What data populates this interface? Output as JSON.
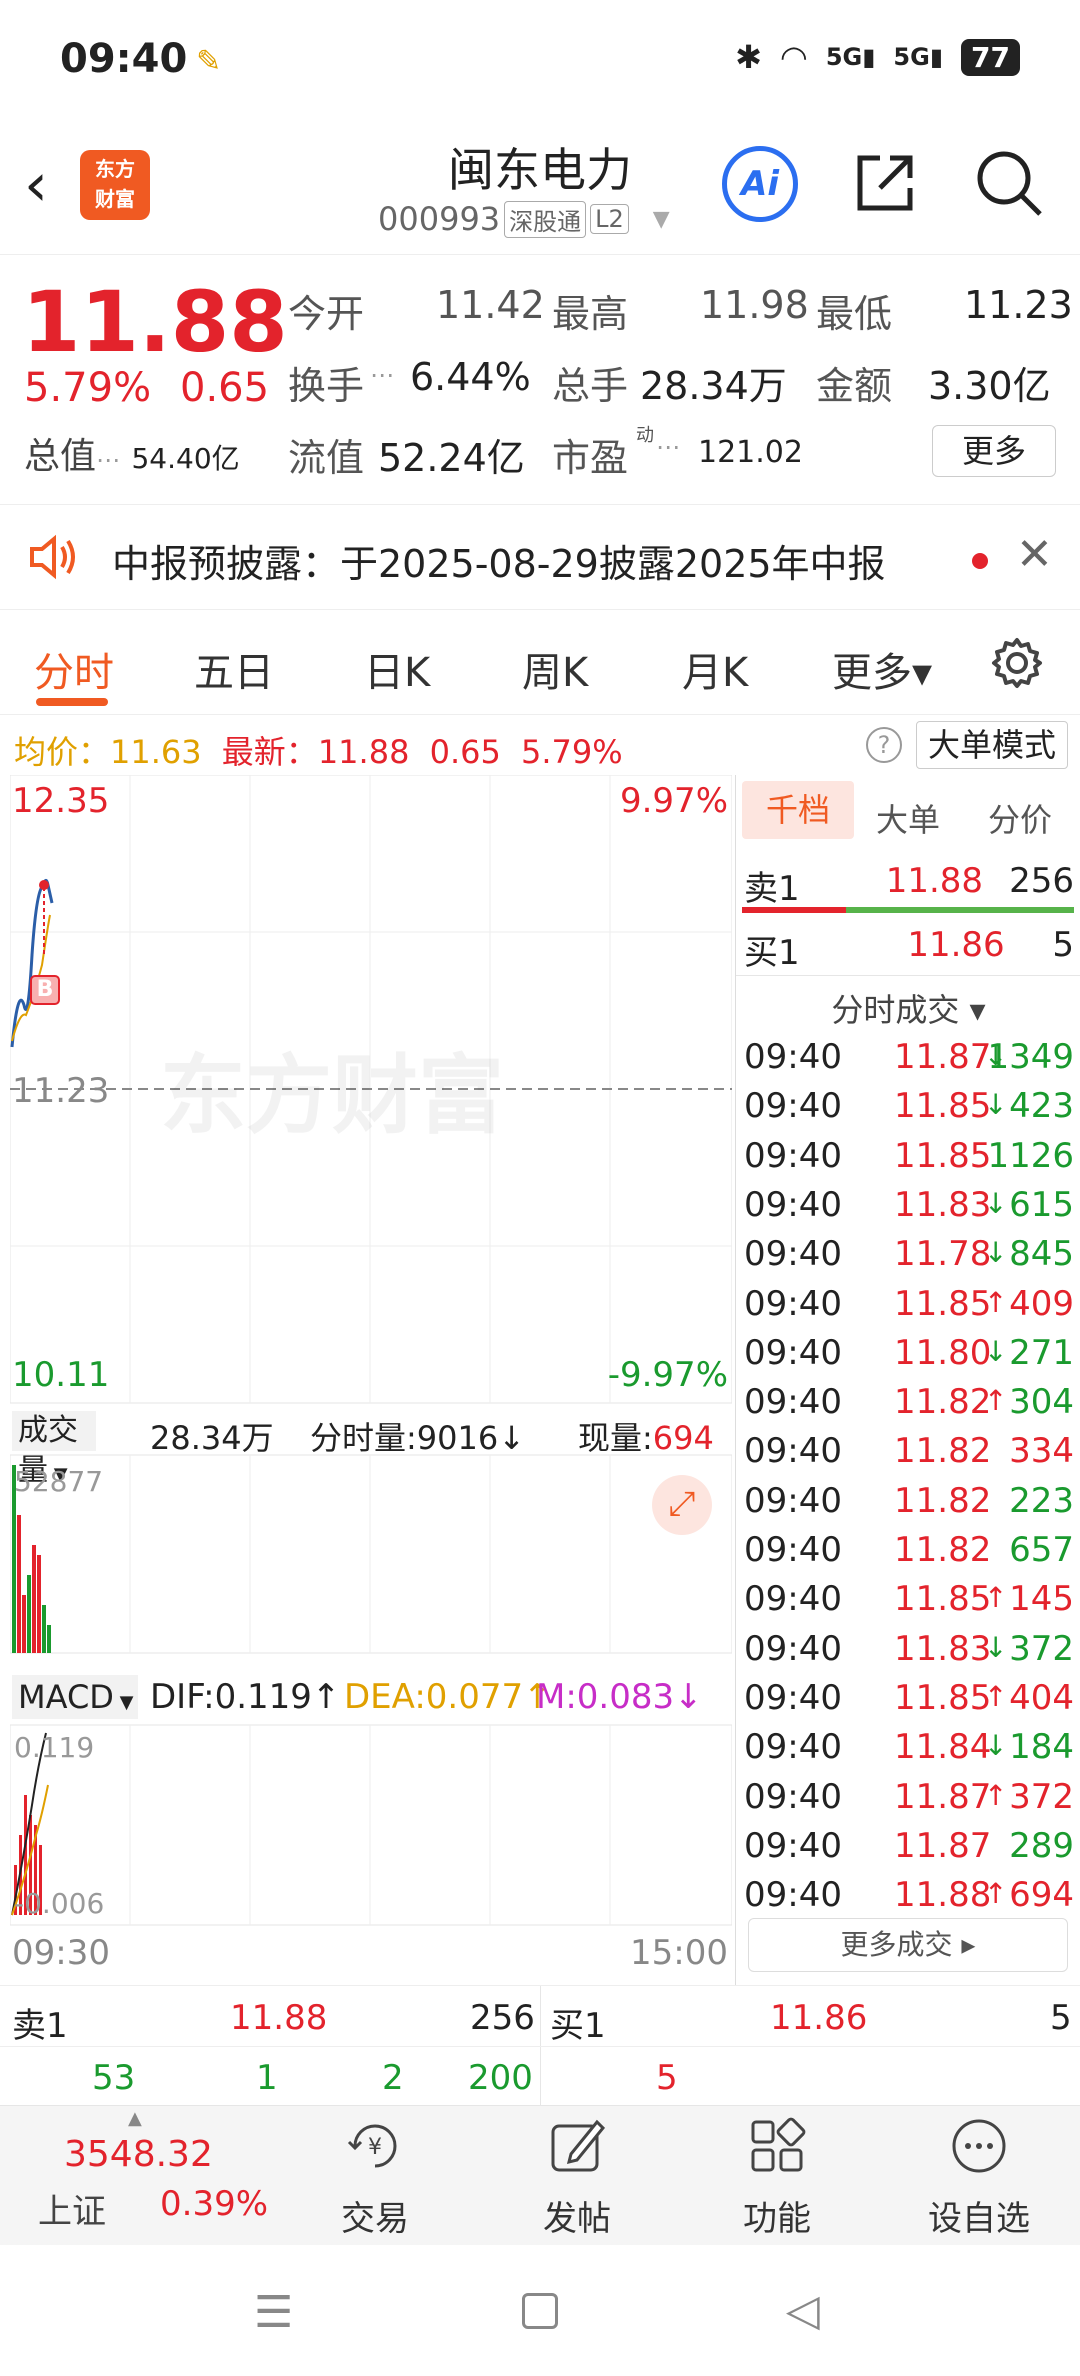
{
  "status": {
    "time": "09:40",
    "battery": "77"
  },
  "header": {
    "logo_line1": "东方",
    "logo_line2": "财富",
    "stock_name": "闽东电力",
    "stock_code": "000993",
    "tag1": "深股通",
    "tag2": "L2"
  },
  "quote": {
    "price": "11.88",
    "pct": "5.79%",
    "change": "0.65",
    "total_val_label": "总值",
    "total_val": "54.40亿",
    "open_label": "今开",
    "open": "11.42",
    "high_label": "最高",
    "high": "11.98",
    "low_label": "最低",
    "low": "11.23",
    "turnover_label": "换手",
    "turnover": "6.44%",
    "volume_label": "总手",
    "volume": "28.34万",
    "amount_label": "金额",
    "amount": "3.30亿",
    "float_label": "流值",
    "float": "52.24亿",
    "pe_label": "市盈",
    "pe_sup": "动",
    "pe": "121.02",
    "more": "更多"
  },
  "notice": {
    "text": "中报预披露：于2025-08-29披露2025年中报"
  },
  "tabs": [
    "分时",
    "五日",
    "日K",
    "周K",
    "月K",
    "更多▾"
  ],
  "avgbar": {
    "avg_label": "均价：",
    "avg": "11.63",
    "latest_label": "最新：",
    "latest": "11.88",
    "change": "0.65",
    "pct": "5.79%",
    "help": "?",
    "big_mode": "大单模式"
  },
  "chart": {
    "top_price": "12.35",
    "top_pct": "9.97%",
    "mid_price": "11.23",
    "bottom_price": "10.11",
    "bottom_pct": "-9.97%",
    "watermark": "东方财富",
    "buy_marker": "B",
    "volume_label": "成交量",
    "volume_total": "28.34万",
    "tick_vol": "分时量:9016↓",
    "now_vol_label": "现量:",
    "now_vol": "694",
    "vol_max": "52877",
    "macd_label": "MACD",
    "dif": "DIF:0.119↑",
    "dea": "DEA:0.077↑",
    "m": "M:0.083↓",
    "macd_max": "0.119",
    "macd_min": "-0.006",
    "time_start": "09:30",
    "time_end": "15:00"
  },
  "rpanel": {
    "tabs": [
      "千档",
      "大单",
      "分价"
    ],
    "sell1_label": "卖1",
    "sell1_price": "11.88",
    "sell1_vol": "256",
    "buy1_label": "买1",
    "buy1_price": "11.86",
    "buy1_vol": "5",
    "trades_title": "分时成交 ▾",
    "trades": [
      {
        "t": "09:40",
        "p": "11.87",
        "d": "↓",
        "v": "1349",
        "pc": "red",
        "vc": "green"
      },
      {
        "t": "09:40",
        "p": "11.85",
        "d": "↓",
        "v": "423",
        "pc": "red",
        "vc": "green"
      },
      {
        "t": "09:40",
        "p": "11.85",
        "d": "",
        "v": "1126",
        "pc": "red",
        "vc": "green"
      },
      {
        "t": "09:40",
        "p": "11.83",
        "d": "↓",
        "v": "615",
        "pc": "red",
        "vc": "green"
      },
      {
        "t": "09:40",
        "p": "11.78",
        "d": "↓",
        "v": "845",
        "pc": "red",
        "vc": "green"
      },
      {
        "t": "09:40",
        "p": "11.85",
        "d": "↑",
        "v": "409",
        "pc": "red",
        "vc": "red"
      },
      {
        "t": "09:40",
        "p": "11.80",
        "d": "↓",
        "v": "271",
        "pc": "red",
        "vc": "green"
      },
      {
        "t": "09:40",
        "p": "11.82",
        "d": "↑",
        "v": "304",
        "pc": "red",
        "vc": "green"
      },
      {
        "t": "09:40",
        "p": "11.82",
        "d": "",
        "v": "334",
        "pc": "red",
        "vc": "red"
      },
      {
        "t": "09:40",
        "p": "11.82",
        "d": "",
        "v": "223",
        "pc": "red",
        "vc": "green"
      },
      {
        "t": "09:40",
        "p": "11.82",
        "d": "",
        "v": "657",
        "pc": "red",
        "vc": "green"
      },
      {
        "t": "09:40",
        "p": "11.85",
        "d": "↑",
        "v": "145",
        "pc": "red",
        "vc": "red"
      },
      {
        "t": "09:40",
        "p": "11.83",
        "d": "↓",
        "v": "372",
        "pc": "red",
        "vc": "green"
      },
      {
        "t": "09:40",
        "p": "11.85",
        "d": "↑",
        "v": "404",
        "pc": "red",
        "vc": "red"
      },
      {
        "t": "09:40",
        "p": "11.84",
        "d": "↓",
        "v": "184",
        "pc": "red",
        "vc": "green"
      },
      {
        "t": "09:40",
        "p": "11.87",
        "d": "↑",
        "v": "372",
        "pc": "red",
        "vc": "red"
      },
      {
        "t": "09:40",
        "p": "11.87",
        "d": "",
        "v": "289",
        "pc": "red",
        "vc": "green"
      },
      {
        "t": "09:40",
        "p": "11.88",
        "d": "↑",
        "v": "694",
        "pc": "red",
        "vc": "red"
      }
    ],
    "more_trades": "更多成交 ▸"
  },
  "book": {
    "sell1_label": "卖1",
    "sell1_price": "11.88",
    "sell1_vol": "256",
    "buy1_label": "买1",
    "buy1_price": "11.86",
    "buy1_vol": "5",
    "sell_detail": [
      "53",
      "1",
      "2",
      "200"
    ],
    "buy_detail": [
      "5"
    ]
  },
  "nav": {
    "index_value": "3548.32",
    "index_name": "上证",
    "index_pct": "0.39%",
    "items": [
      "交易",
      "发帖",
      "功能",
      "设自选"
    ]
  },
  "colors": {
    "up": "#e3232c",
    "down": "#1a9a2e",
    "accent": "#f05a22",
    "ai": "#2b6ef0"
  }
}
